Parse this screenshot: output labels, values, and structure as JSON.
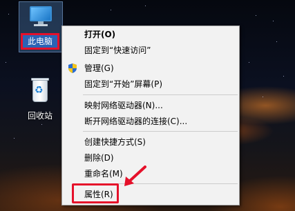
{
  "desktop": {
    "icons": [
      {
        "label": "此电脑"
      },
      {
        "label": "回收站"
      }
    ]
  },
  "context_menu": {
    "items": [
      {
        "label": "打开(O)",
        "bold": true
      },
      {
        "label": "固定到“快速访问”"
      },
      {
        "label": "管理(G)",
        "icon": "shield-icon"
      },
      {
        "label": "固定到“开始”屏幕(P)"
      },
      {
        "label": "映射网络驱动器(N)..."
      },
      {
        "label": "断开网络驱动器的连接(C)..."
      },
      {
        "label": "创建快捷方式(S)"
      },
      {
        "label": "删除(D)"
      },
      {
        "label": "重命名(M)"
      },
      {
        "label": "属性(R)"
      }
    ]
  },
  "colors": {
    "highlight": "#e5102a",
    "menu_bg": "#f2f2f2",
    "selection_bg": "#2b63b5"
  }
}
